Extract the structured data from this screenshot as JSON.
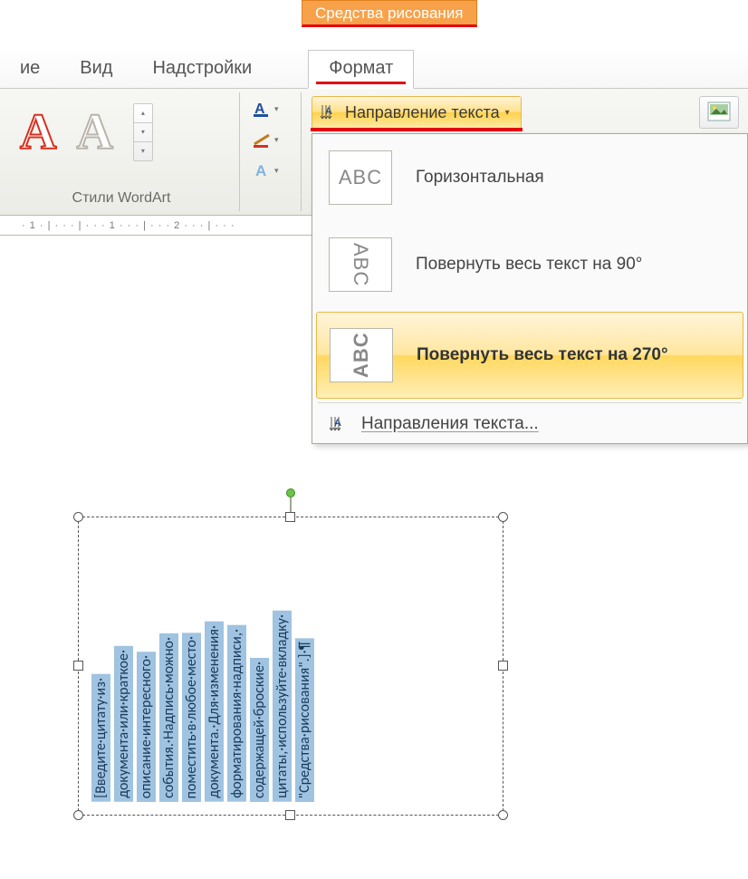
{
  "contextual_tab_title": "Средства рисования",
  "tabs": {
    "t1_suffix": "ие",
    "view": "Вид",
    "addins": "Надстройки",
    "format": "Формат"
  },
  "wordart_group_label": "Стили WordArt",
  "direction_button_label": "Направление текста",
  "ruler_text": "· 1 · | · · · | · · · 1 · · · | · · · 2 · · · | · · · ",
  "dropdown": {
    "horizontal": "Горизонтальная",
    "rotate90": "Повернуть весь текст на 90°",
    "rotate270": "Повернуть весь текст на 270°",
    "more": "Направления текста...",
    "thumb_text": "ABC"
  },
  "textbox_lines": [
    "[Введите·цитату·из·",
    "документа·или·краткое·",
    "описание·интересного·",
    "события.·Надпись·можно·",
    "поместить·в·любое·место·",
    "документа.·Для·изменения·",
    "форматирования·надписи,·",
    "содержащей·броские·",
    "цитаты,·используйте·вкладку·",
    "\"Средства·рисования\".]·¶"
  ],
  "right_clip_char": "6"
}
